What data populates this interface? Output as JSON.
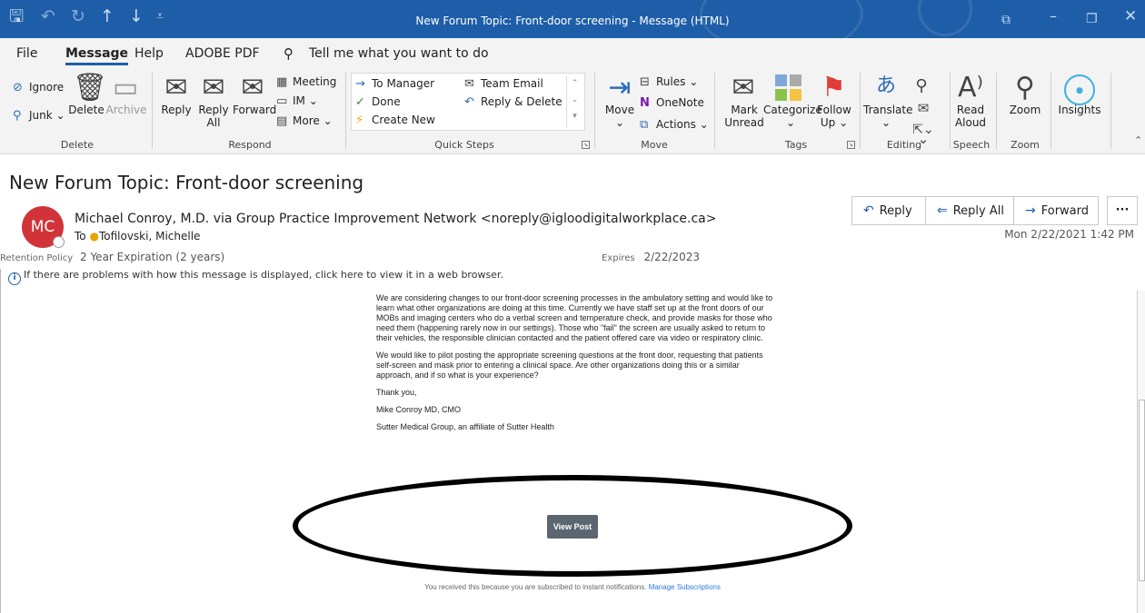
{
  "window": {
    "title": "New Forum Topic: Front-door screening  -  Message (HTML)",
    "colors": {
      "title_bar": "#1e5ea8",
      "ribbon": "#f3f3f3"
    }
  },
  "menu": {
    "file": "File",
    "message": "Message",
    "help": "Help",
    "adobe_pdf": "ADOBE PDF",
    "tell_me": "Tell me what you want to do"
  },
  "ribbon": {
    "delete_group": {
      "ignore": "Ignore",
      "junk": "Junk ⌄",
      "delete": "Delete",
      "archive": "Archive",
      "label": "Delete"
    },
    "respond_group": {
      "reply": "Reply",
      "reply_all_1": "Reply",
      "reply_all_2": "All",
      "forward": "Forward",
      "meeting": "Meeting",
      "im": "IM ⌄",
      "more": "More ⌄",
      "label": "Respond"
    },
    "quick_steps": {
      "to_manager": "To Manager",
      "done": "Done",
      "create_new": "Create New",
      "team_email": "Team Email",
      "reply_delete": "Reply & Delete",
      "label": "Quick Steps"
    },
    "move_group": {
      "move": "Move",
      "rules": "Rules ⌄",
      "onenote": "OneNote",
      "actions": "Actions ⌄",
      "label": "Move"
    },
    "tags_group": {
      "mark_unread_1": "Mark",
      "mark_unread_2": "Unread",
      "categorize": "Categorize",
      "follow_up_1": "Follow",
      "follow_up_2": "Up ⌄",
      "label": "Tags"
    },
    "editing_group": {
      "translate": "Translate",
      "label": "Editing"
    },
    "speech_group": {
      "read_aloud_1": "Read",
      "read_aloud_2": "Aloud",
      "label": "Speech"
    },
    "zoom_group": {
      "zoom": "Zoom",
      "label": "Zoom"
    },
    "insights": "Insights"
  },
  "message": {
    "subject": "New Forum Topic: Front-door screening",
    "avatar_initials": "MC",
    "sender": "Michael Conroy, M.D. via Group Practice Improvement Network <noreply@igloodigitalworkplace.ca>",
    "to_label": "To",
    "to": "Tofilovski, Michelle",
    "retention_label": "Retention Policy",
    "retention_value": "2 Year Expiration (2 years)",
    "expires_label": "Expires",
    "expires_value": "2/22/2023",
    "info_bar": "If there are problems with how this message is displayed, click here to view it in a web browser.",
    "date": "Mon 2/22/2021 1:42 PM",
    "actions": {
      "reply": "Reply",
      "reply_all": "Reply All",
      "forward": "Forward",
      "more": "···"
    }
  },
  "body": {
    "paragraph_1": "We are considering changes to our front-door screening processes in the ambulatory setting and would like to learn what other organizations are doing at this time. Currently we have staff set up at the front doors of our MOBs and imaging centers who do a verbal screen and temperature check, and provide masks for those who need them (happening rarely now in our settings). Those who \"fail\" the screen are usually asked to return to their vehicles, the responsible clinician contacted and the patient offered care via video or respiratory clinic.",
    "paragraph_2": "We would like to pilot posting the appropriate screening questions at the front door, requesting that patients self-screen and mask prior to entering a clinical space. Are other organizations doing this or a similar approach, and if so what is your experience?",
    "thanks": "Thank you,",
    "signature_name": "Mike Conroy MD, CMO",
    "signature_org": "Sutter Medical Group, an affiliate of Sutter Health",
    "view_post": "View Post",
    "footer_text": "You received this because you are subscribed to instant notifications.",
    "footer_link": "Manage Subscriptions"
  }
}
